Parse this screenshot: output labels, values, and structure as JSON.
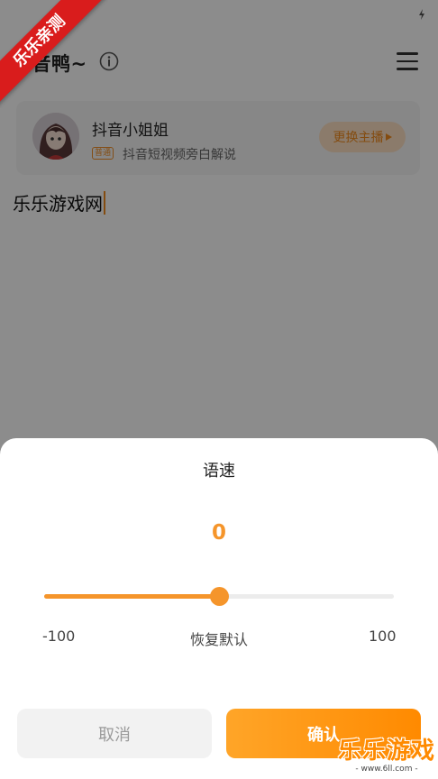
{
  "app": {
    "title": "配音鸭~",
    "voice": {
      "name": "抖音小姐姐",
      "tag": "普通",
      "description": "抖音短视频旁白解说",
      "change_label": "更换主播"
    },
    "editor_text": "乐乐游戏网"
  },
  "watermark": {
    "ribbon_text": "乐乐亲测",
    "site_name": "乐乐游戏",
    "site_url": "- www.6ll.com -"
  },
  "speed_sheet": {
    "title": "语速",
    "value": "0",
    "slider": {
      "min": -100,
      "max": 100,
      "current": 0
    },
    "min_label": "-100",
    "reset_label": "恢复默认",
    "max_label": "100",
    "cancel_label": "取消",
    "confirm_label": "确认"
  },
  "colors": {
    "accent": "#f5952b",
    "confirm_gradient_start": "#ffa528",
    "confirm_gradient_end": "#ff8a00",
    "ribbon": "#d91c1c"
  },
  "icons": [
    "wifi-icon",
    "signal-icon",
    "battery-icon",
    "info-icon",
    "menu-icon",
    "play-triangle-icon"
  ]
}
